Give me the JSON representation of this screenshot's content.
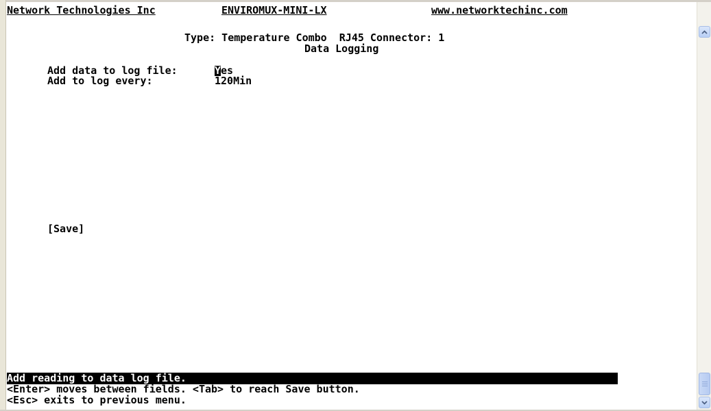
{
  "header": {
    "company": "Network Technologies Inc",
    "product": "ENVIROMUX-MINI-LX",
    "website": "www.networktechinc.com"
  },
  "sensor": {
    "type_line": "Type: Temperature Combo  RJ45 Connector: 1",
    "section_title": "Data Logging"
  },
  "fields": {
    "add_to_log_label": "Add data to log file:",
    "add_to_log_value": "Yes",
    "log_every_label": "Add to log every:",
    "log_every_value": "120Min"
  },
  "save_button": "[Save]",
  "status": {
    "help": "Add reading to data log file.",
    "hint1": "<Enter> moves between fields. <Tab> to reach Save button.",
    "hint2": "<Esc> exits to previous menu."
  },
  "icons": {
    "scroll_up": "chevron-up-icon",
    "scroll_down": "chevron-down-icon"
  }
}
